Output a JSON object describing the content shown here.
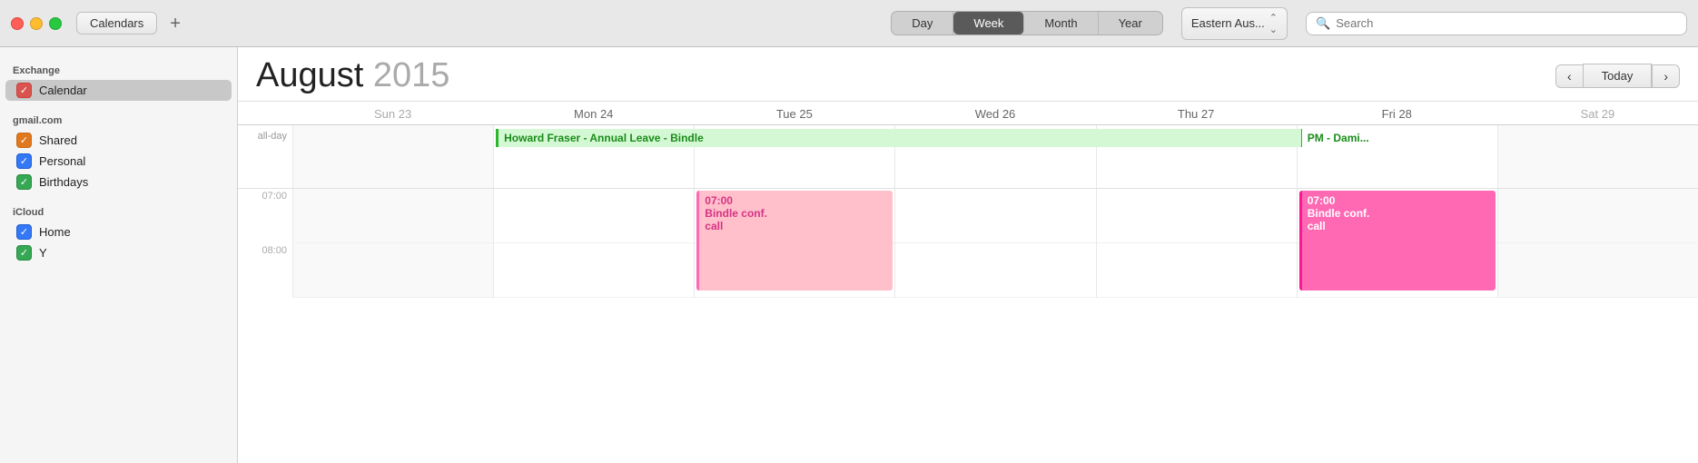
{
  "titlebar": {
    "calendars_label": "Calendars",
    "add_label": "+",
    "views": [
      "Day",
      "Week",
      "Month",
      "Year"
    ],
    "active_view": "Week",
    "timezone": "Eastern Aus...",
    "search_placeholder": "Search"
  },
  "sidebar": {
    "sections": [
      {
        "title": "Exchange",
        "items": [
          {
            "label": "Calendar",
            "color": "red",
            "selected": true
          }
        ]
      },
      {
        "title": "gmail.com",
        "items": [
          {
            "label": "Shared",
            "color": "orange"
          },
          {
            "label": "Personal",
            "color": "blue"
          },
          {
            "label": "Birthdays",
            "color": "green"
          }
        ]
      },
      {
        "title": "iCloud",
        "items": [
          {
            "label": "Home",
            "color": "blue"
          },
          {
            "label": "Y",
            "color": "darkgreen"
          }
        ]
      }
    ]
  },
  "calendar": {
    "month": "August",
    "year": "2015",
    "nav": {
      "prev": "‹",
      "today": "Today",
      "next": "›"
    },
    "days": [
      {
        "label": "Sun",
        "num": "23",
        "today": false
      },
      {
        "label": "Mon",
        "num": "24",
        "today": false
      },
      {
        "label": "Tue",
        "num": "25",
        "today": false
      },
      {
        "label": "Wed",
        "num": "26",
        "today": false
      },
      {
        "label": "Thu",
        "num": "27",
        "today": false
      },
      {
        "label": "Fri",
        "num": "28",
        "today": false
      },
      {
        "label": "Sat",
        "num": "29",
        "today": false
      }
    ],
    "allday_label": "all-day",
    "allday_events": [
      {
        "text": "Howard Fraser - Annual Leave - Bindle",
        "col_start": 2,
        "col_end": 6
      }
    ],
    "pm_dami": "PM - Dami...",
    "time_slots": [
      {
        "label": "07:00",
        "events": [
          {
            "col": 3,
            "time": "07:00",
            "title": "Bindle conf.\ncall",
            "style": "pink"
          },
          {
            "col": 6,
            "time": "07:00",
            "title": "Bindle conf.\ncall",
            "style": "hot-pink"
          }
        ]
      },
      {
        "label": "08:00",
        "events": []
      }
    ]
  }
}
